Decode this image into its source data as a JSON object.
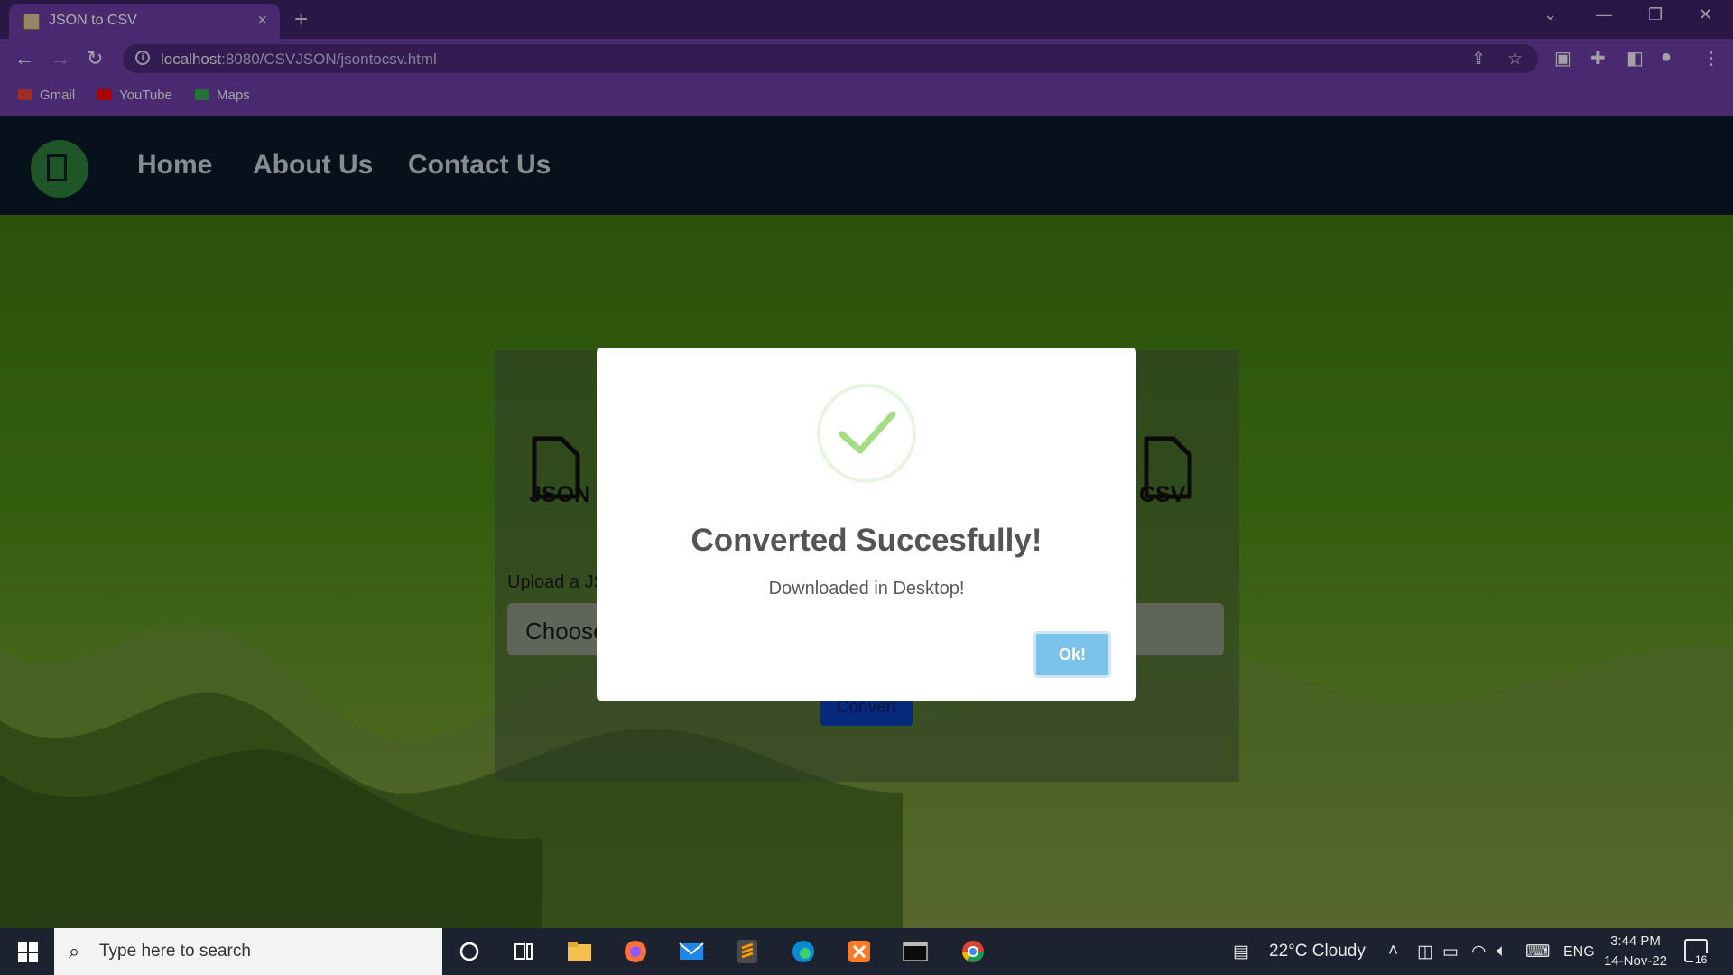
{
  "browser": {
    "tab_title": "JSON to CSV",
    "tab_close": "×",
    "new_tab": "+",
    "url_host": "localhost",
    "url_rest": ":8080/CSVJSON/jsontocsv.html",
    "bookmarks": [
      "Gmail",
      "YouTube",
      "Maps"
    ]
  },
  "site_nav": {
    "links": [
      "Home",
      "About Us",
      "Contact Us"
    ]
  },
  "converter": {
    "from_label": "JSON",
    "to_label": "CSV",
    "upload_label": "Upload a JS",
    "choose_label": "Choose",
    "convert_label": "Convert"
  },
  "dialog": {
    "title": "Converted Succesfully!",
    "message": "Downloaded in Desktop!",
    "ok_label": "Ok!",
    "success_color": "#a5dc86",
    "ok_color": "#7cc3ea"
  },
  "taskbar": {
    "search_placeholder": "Type here to search",
    "weather": "22°C  Cloudy",
    "language": "ENG",
    "time": "3:44 PM",
    "date": "14-Nov-22",
    "notification_count": "16"
  }
}
